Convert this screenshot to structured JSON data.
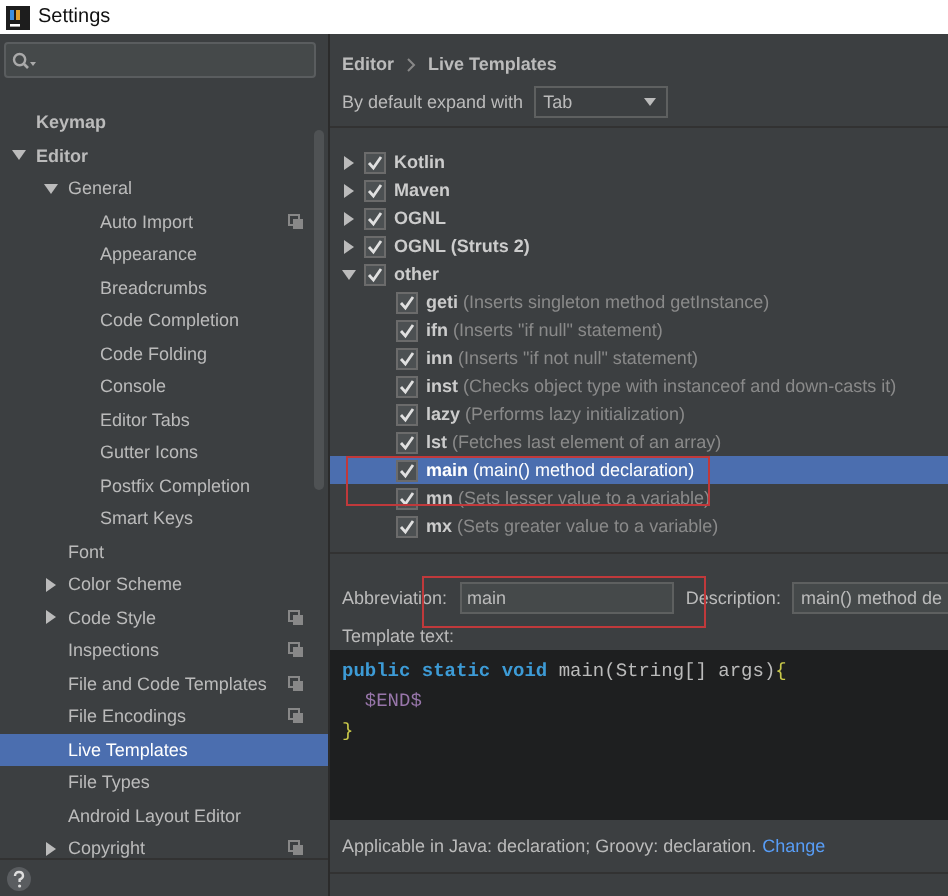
{
  "window": {
    "title": "Settings"
  },
  "sidebar": {
    "items": [
      {
        "label": "Keymap",
        "bold": true
      },
      {
        "label": "Editor",
        "bold": true,
        "expanded": true,
        "children": [
          {
            "label": "General",
            "expanded": true,
            "children": [
              {
                "label": "Auto Import",
                "project_scoped": true
              },
              {
                "label": "Appearance"
              },
              {
                "label": "Breadcrumbs"
              },
              {
                "label": "Code Completion"
              },
              {
                "label": "Code Folding"
              },
              {
                "label": "Console"
              },
              {
                "label": "Editor Tabs"
              },
              {
                "label": "Gutter Icons"
              },
              {
                "label": "Postfix Completion"
              },
              {
                "label": "Smart Keys"
              }
            ]
          },
          {
            "label": "Font"
          },
          {
            "label": "Color Scheme",
            "expanded": false
          },
          {
            "label": "Code Style",
            "expanded": false,
            "project_scoped": true
          },
          {
            "label": "Inspections",
            "project_scoped": true
          },
          {
            "label": "File and Code Templates",
            "project_scoped": true
          },
          {
            "label": "File Encodings",
            "project_scoped": true
          },
          {
            "label": "Live Templates",
            "selected": true
          },
          {
            "label": "File Types"
          },
          {
            "label": "Android Layout Editor"
          },
          {
            "label": "Copyright",
            "expanded": false,
            "project_scoped": true
          }
        ]
      }
    ]
  },
  "breadcrumb": [
    "Editor",
    "Live Templates"
  ],
  "expand_with": {
    "label": "By default expand with",
    "value": "Tab"
  },
  "templates": [
    {
      "kind": "group",
      "name": "Kotlin",
      "checked": true,
      "expanded": false
    },
    {
      "kind": "group",
      "name": "Maven",
      "checked": true,
      "expanded": false
    },
    {
      "kind": "group",
      "name": "OGNL",
      "checked": true,
      "expanded": false
    },
    {
      "kind": "group",
      "name": "OGNL (Struts 2)",
      "checked": true,
      "expanded": false
    },
    {
      "kind": "group",
      "name": "other",
      "checked": true,
      "expanded": true,
      "children": [
        {
          "kind": "template",
          "name": "geti",
          "description": "(Inserts singleton method getInstance)",
          "checked": true,
          "selected": false
        },
        {
          "kind": "template",
          "name": "ifn",
          "description": "(Inserts \"if null\" statement)",
          "checked": true,
          "selected": false
        },
        {
          "kind": "template",
          "name": "inn",
          "description": "(Inserts \"if not null\" statement)",
          "checked": true,
          "selected": false
        },
        {
          "kind": "template",
          "name": "inst",
          "description": "(Checks object type with instanceof and down-casts it)",
          "checked": true,
          "selected": false
        },
        {
          "kind": "template",
          "name": "lazy",
          "description": "(Performs lazy initialization)",
          "checked": true,
          "selected": false
        },
        {
          "kind": "template",
          "name": "lst",
          "description": "(Fetches last element of an array)",
          "checked": true,
          "selected": false
        },
        {
          "kind": "template",
          "name": "main",
          "description": "(main() method declaration)",
          "checked": true,
          "selected": true
        },
        {
          "kind": "template",
          "name": "mn",
          "description": "(Sets lesser value to a variable)",
          "checked": true,
          "selected": false
        },
        {
          "kind": "template",
          "name": "mx",
          "description": "(Sets greater value to a variable)",
          "checked": true,
          "selected": false
        }
      ]
    }
  ],
  "abbreviation": {
    "label": "Abbreviation:",
    "value": "main"
  },
  "description": {
    "label": "Description:",
    "value": "main() method de"
  },
  "template_text": {
    "label": "Template text:",
    "lines": [
      [
        {
          "kind": "keyword",
          "text": "public static void"
        },
        {
          "kind": "plain",
          "text": " main(String[] args)"
        },
        {
          "kind": "brace",
          "text": "{"
        }
      ],
      [
        {
          "kind": "variable",
          "text": "  $END$"
        }
      ],
      [
        {
          "kind": "brace",
          "text": "}"
        }
      ]
    ]
  },
  "applicable": {
    "text": "Applicable in Java: declaration; Groovy: declaration.",
    "link": "Change"
  }
}
